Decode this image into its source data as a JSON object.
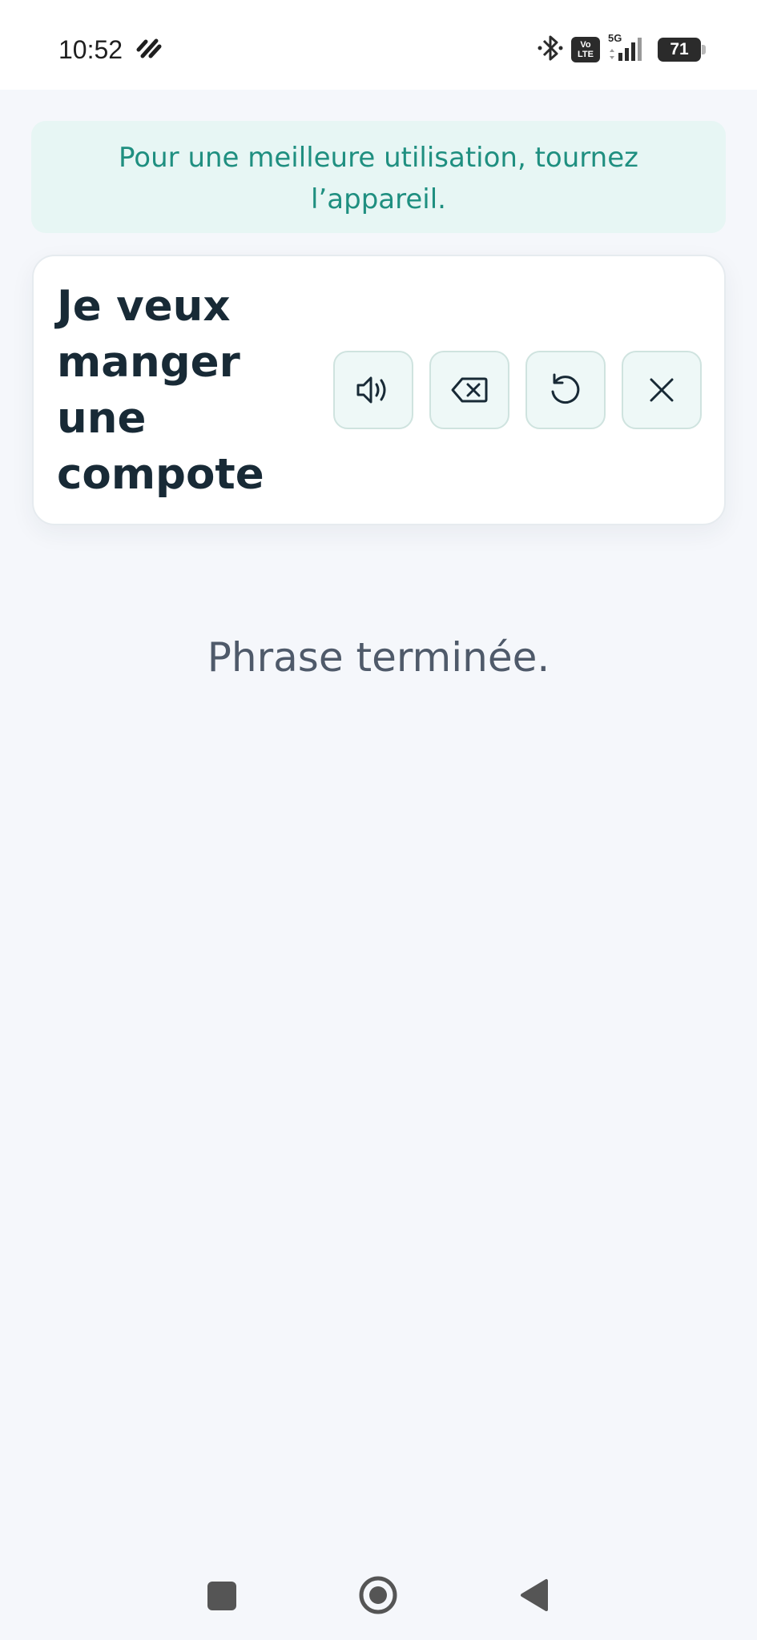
{
  "status_bar": {
    "time": "10:52",
    "volte_line1": "Vo",
    "volte_line2": "LTE",
    "network": "5G",
    "battery": "71"
  },
  "banner": {
    "message": "Pour une meilleure utilisation, tournez l’appareil."
  },
  "phrase_card": {
    "sentence": "Je veux manger une compote",
    "actions": [
      "speaker-icon",
      "backspace-icon",
      "reset-icon",
      "close-icon"
    ]
  },
  "status_message": "Phrase terminée.",
  "colors": {
    "banner_bg": "#e7f6f4",
    "banner_text": "#1f8f80",
    "button_bg": "#eef8f7",
    "phrase_text": "#182a36"
  }
}
